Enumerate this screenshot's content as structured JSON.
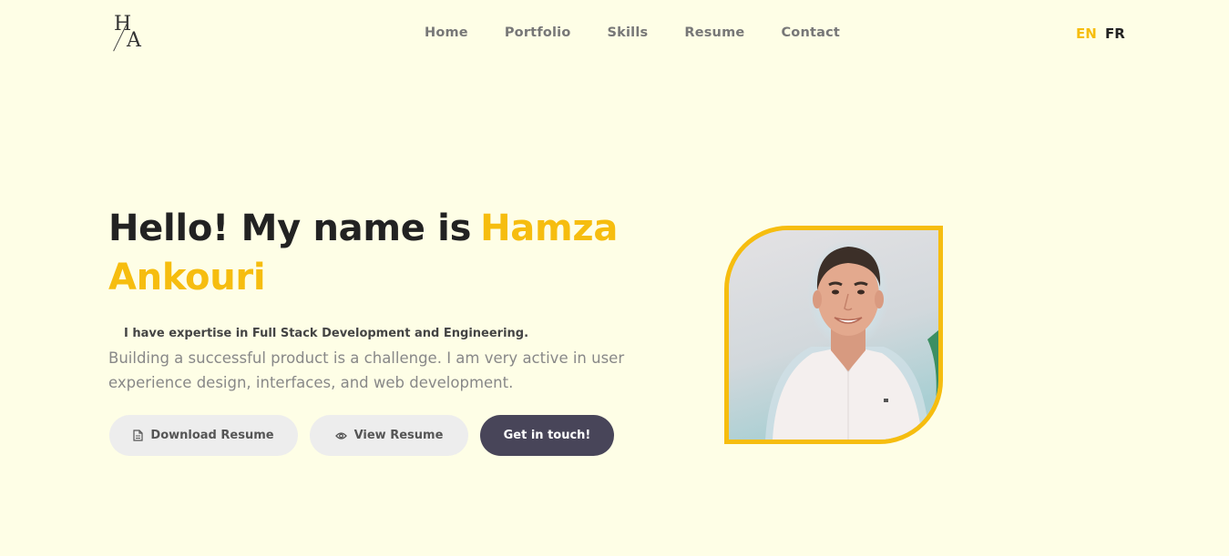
{
  "header": {
    "logo_text": "H/A",
    "nav": [
      "Home",
      "Portfolio",
      "Skills",
      "Resume",
      "Contact"
    ],
    "lang": {
      "en": "EN",
      "fr": "FR"
    }
  },
  "hero": {
    "title_prefix": "Hello! My name is",
    "title_name_first": "Hamza",
    "title_name_last": "Ankouri",
    "expertise": "I have expertise in Full Stack Development and Engineering.",
    "description": "Building a successful product is a challenge. I am very active in user experience design, interfaces, and web development.",
    "buttons": {
      "download": "Download Resume",
      "view": "View Resume",
      "touch": "Get in touch!"
    }
  },
  "colors": {
    "background": "#fefee6",
    "accent": "#f6bd0f",
    "dark_button": "#484559",
    "light_button": "#ededed"
  },
  "icons": {
    "download": "document-icon",
    "view": "eye-icon"
  }
}
